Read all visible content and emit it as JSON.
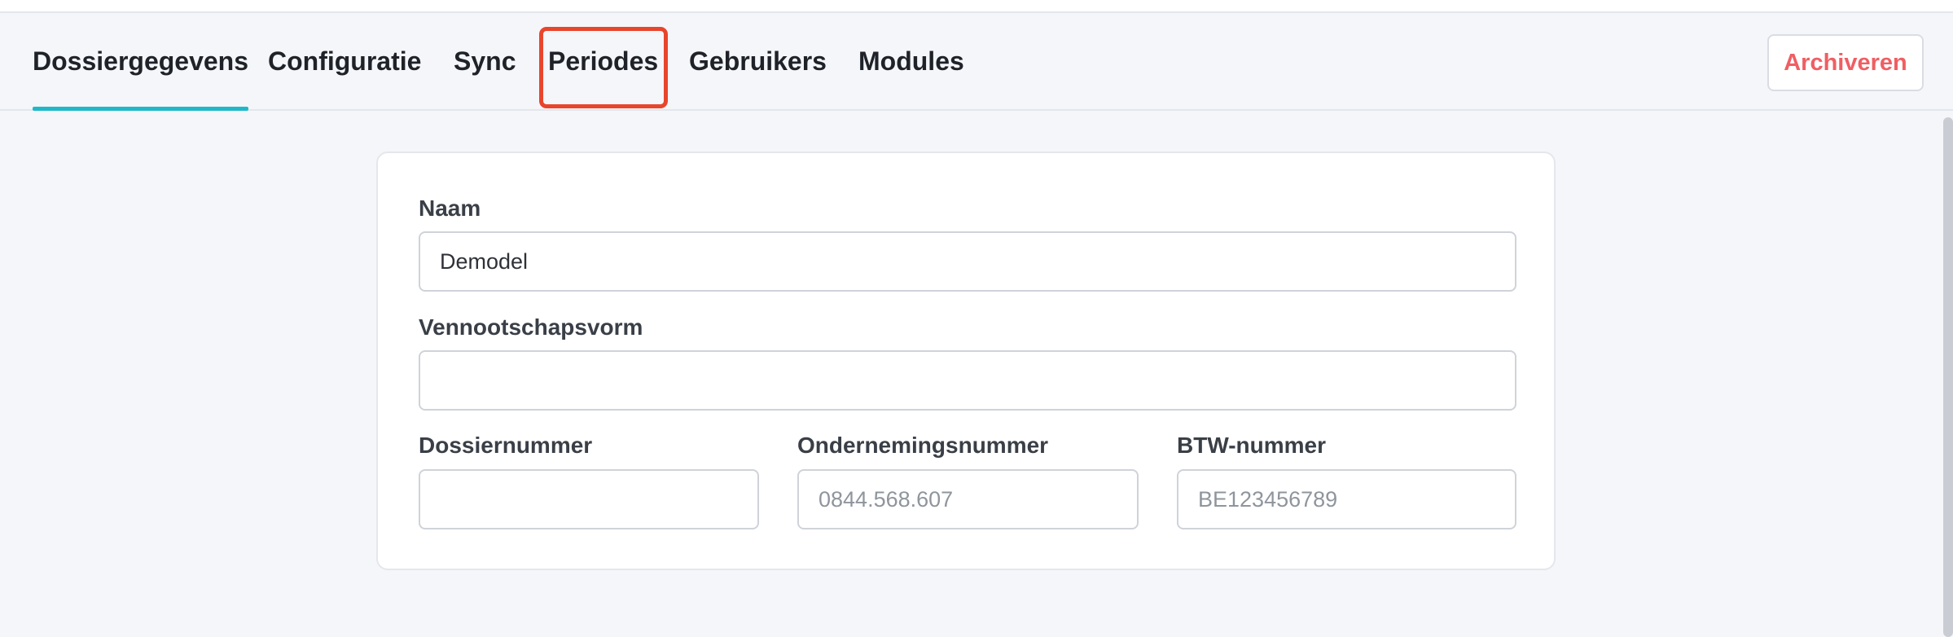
{
  "tabs": [
    {
      "label": "Dossiergegevens",
      "active": true
    },
    {
      "label": "Configuratie",
      "active": false
    },
    {
      "label": "Sync",
      "active": false
    },
    {
      "label": "Periodes",
      "active": false,
      "highlighted": true
    },
    {
      "label": "Gebruikers",
      "active": false
    },
    {
      "label": "Modules",
      "active": false
    }
  ],
  "header": {
    "archive_label": "Archiveren"
  },
  "form": {
    "naam": {
      "label": "Naam",
      "value": "Demodel",
      "placeholder": ""
    },
    "vennootschapsvorm": {
      "label": "Vennootschapsvorm",
      "value": "",
      "placeholder": ""
    },
    "dossiernummer": {
      "label": "Dossiernummer",
      "value": "",
      "placeholder": ""
    },
    "ondernemingsnummer": {
      "label": "Ondernemingsnummer",
      "value": "",
      "placeholder": "0844.568.607"
    },
    "btw_nummer": {
      "label": "BTW-nummer",
      "value": "",
      "placeholder": "BE123456789"
    }
  },
  "colors": {
    "active_tab_underline": "#1fb8c9",
    "highlight_box": "#e8452c",
    "archive_text": "#ef5f63"
  }
}
